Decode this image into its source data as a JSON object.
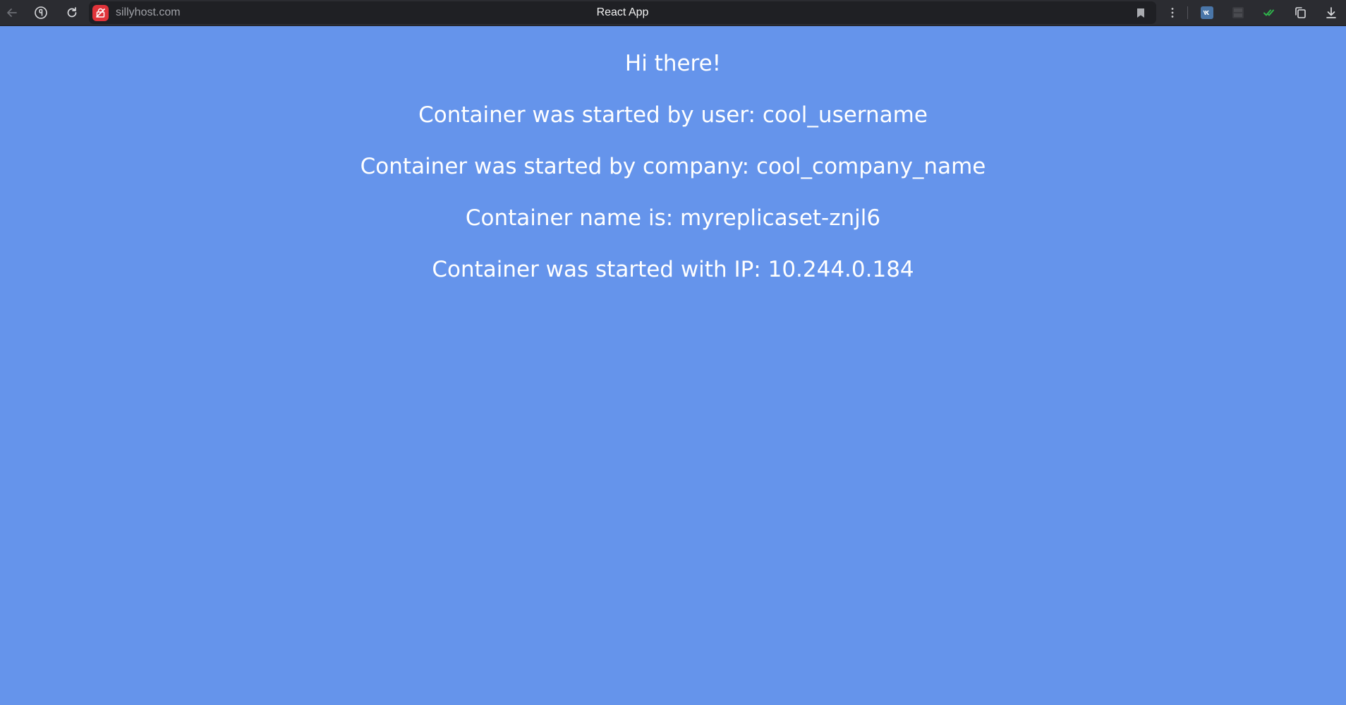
{
  "browser": {
    "url": "sillyhost.com",
    "tab_title": "React App",
    "icons": {
      "back": "arrow-left-icon",
      "yandex": "yandex-logo-icon",
      "reload": "reload-icon",
      "site": "site-badge-icon",
      "bookmark": "bookmark-icon",
      "menu": "kebab-menu-icon",
      "vk": "vk-extension-icon",
      "ext_box": "extension-box-icon",
      "check": "checkmark-extension-icon",
      "copy": "copy-extension-icon",
      "download": "download-icon"
    },
    "colors": {
      "topbar": "#2b2c31",
      "site_badge": "#e0333a",
      "vk": "#4a76a8",
      "check": "#2fb34b"
    }
  },
  "page": {
    "background": "#6594eb",
    "greeting": "Hi there!",
    "user_line": "Container was started by user: cool_username",
    "company_line": "Container was started by company: cool_company_name",
    "name_line": "Container name is: myreplicaset-znjl6",
    "ip_line": "Container was started with IP: 10.244.0.184"
  }
}
